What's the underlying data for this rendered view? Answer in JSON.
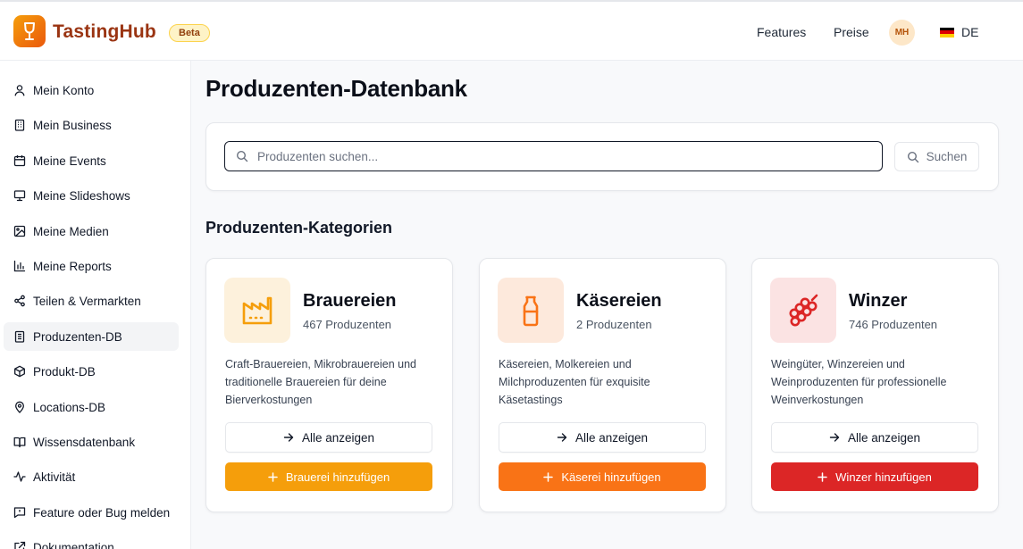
{
  "header": {
    "brand": "TastingHub",
    "badge": "Beta",
    "nav": {
      "features": "Features",
      "preise": "Preise"
    },
    "avatar_initials": "MH",
    "language": "DE",
    "logo_icon": "wine-glass-icon"
  },
  "sidebar": {
    "items": [
      {
        "label": "Mein Konto",
        "icon": "user-icon"
      },
      {
        "label": "Mein Business",
        "icon": "building-icon"
      },
      {
        "label": "Meine Events",
        "icon": "calendar-icon"
      },
      {
        "label": "Meine Slideshows",
        "icon": "presentation-icon"
      },
      {
        "label": "Meine Medien",
        "icon": "image-icon"
      },
      {
        "label": "Meine Reports",
        "icon": "bar-chart-icon"
      },
      {
        "label": "Teilen & Vermarkten",
        "icon": "share-icon"
      },
      {
        "label": "Produzenten-DB",
        "icon": "database-building-icon",
        "active": true
      },
      {
        "label": "Produkt-DB",
        "icon": "package-icon"
      },
      {
        "label": "Locations-DB",
        "icon": "map-pin-icon"
      },
      {
        "label": "Wissensdatenbank",
        "icon": "book-icon"
      },
      {
        "label": "Aktivität",
        "icon": "activity-icon"
      },
      {
        "label": "Feature oder Bug melden",
        "icon": "message-icon"
      },
      {
        "label": "Dokumentation",
        "icon": "external-link-icon"
      }
    ]
  },
  "main": {
    "title": "Produzenten-Datenbank",
    "search": {
      "placeholder": "Produzenten suchen...",
      "value": "",
      "button_label": "Suchen"
    },
    "section_title": "Produzenten-Kategorien",
    "categories": [
      {
        "name": "Brauereien",
        "count": "467 Produzenten",
        "description": "Craft-Brauereien, Mikrobrauereien und traditionelle Brauereien für deine Bierverkostungen",
        "view_all": "Alle anzeigen",
        "add_label": "Brauerei hinzufügen",
        "icon": "factory-icon",
        "accent": "#f59e0b",
        "icon_bg": "#fdf1dc"
      },
      {
        "name": "Käsereien",
        "count": "2 Produzenten",
        "description": "Käsereien, Molkereien und Milchproduzenten für exquisite Käsetastings",
        "view_all": "Alle anzeigen",
        "add_label": "Käserei hinzufügen",
        "icon": "milk-bottle-icon",
        "accent": "#f97316",
        "icon_bg": "#fde9dc"
      },
      {
        "name": "Winzer",
        "count": "746 Produzenten",
        "description": "Weingüter, Winzereien und Weinproduzenten für professionelle Weinverkostungen",
        "view_all": "Alle anzeigen",
        "add_label": "Winzer hinzufügen",
        "icon": "grapes-icon",
        "accent": "#dc2626",
        "icon_bg": "#fbe3e3"
      }
    ]
  }
}
